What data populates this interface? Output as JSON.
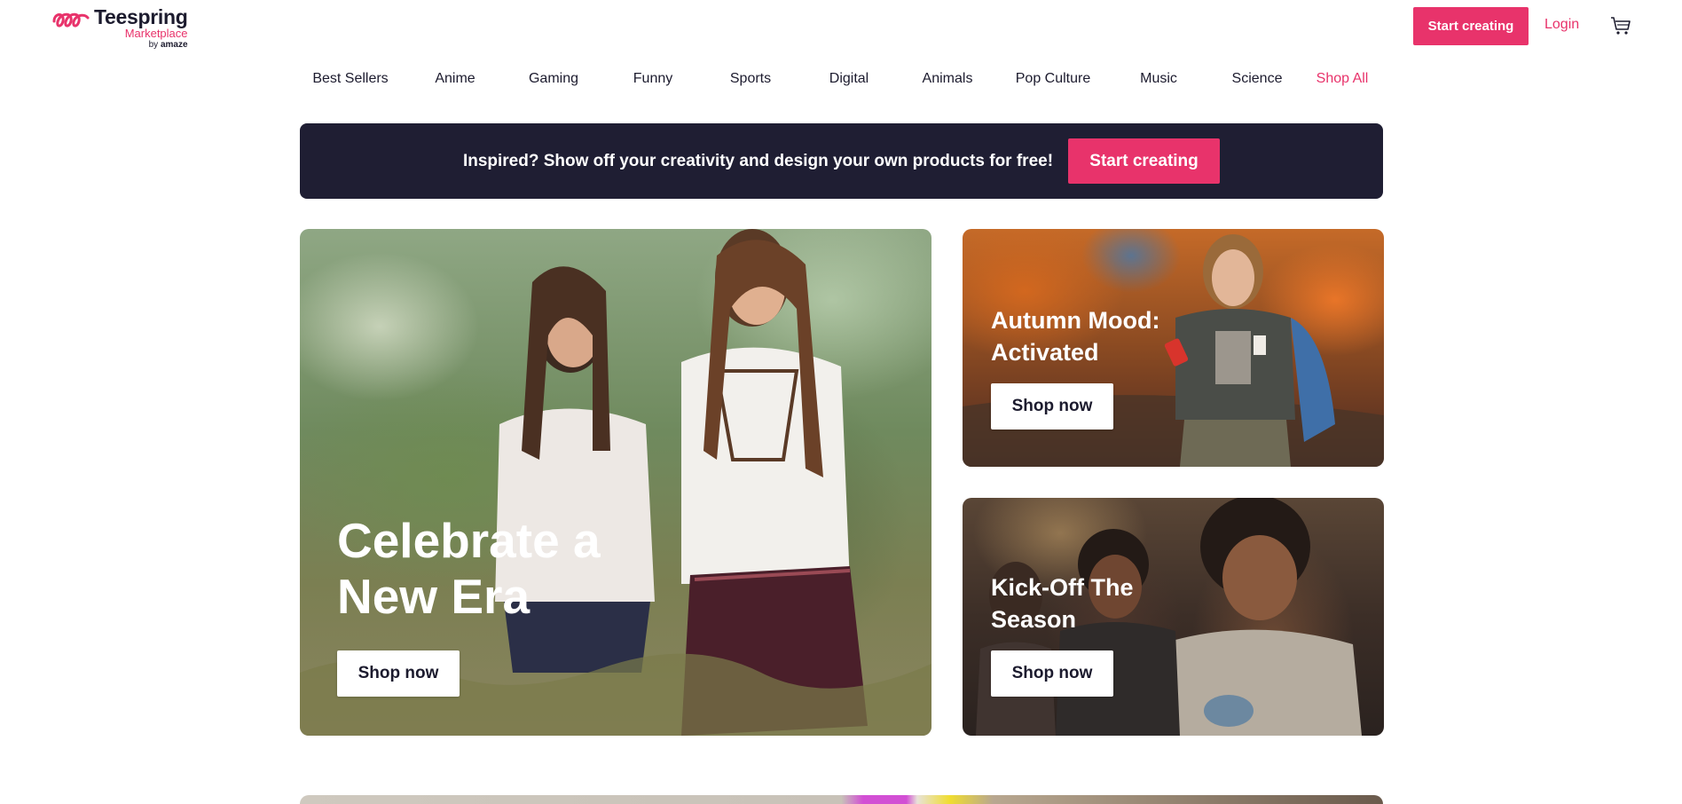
{
  "header": {
    "logo_name": "Teespring",
    "logo_sub": "Marketplace",
    "logo_by": "by",
    "logo_by_brand": "amaze",
    "start_creating_label": "Start creating",
    "login_label": "Login",
    "cart_icon": "cart-icon"
  },
  "nav": {
    "items": [
      {
        "label": "Best Sellers"
      },
      {
        "label": "Anime"
      },
      {
        "label": "Gaming"
      },
      {
        "label": "Funny"
      },
      {
        "label": "Sports"
      },
      {
        "label": "Digital"
      },
      {
        "label": "Animals"
      },
      {
        "label": "Pop Culture"
      },
      {
        "label": "Music"
      },
      {
        "label": "Science"
      },
      {
        "label": "Shop All"
      }
    ]
  },
  "banner": {
    "text": "Inspired? Show off your creativity and design your own products for free!",
    "button_label": "Start creating"
  },
  "cards": [
    {
      "title": "Celebrate a New Era",
      "button_label": "Shop now"
    },
    {
      "title": "Autumn Mood: Activated",
      "button_label": "Shop now"
    },
    {
      "title": "Kick-Off The Season",
      "button_label": "Shop now"
    }
  ],
  "colors": {
    "accent": "#e8336b",
    "banner_bg": "#1f1e33",
    "text": "#1c1b2e"
  }
}
